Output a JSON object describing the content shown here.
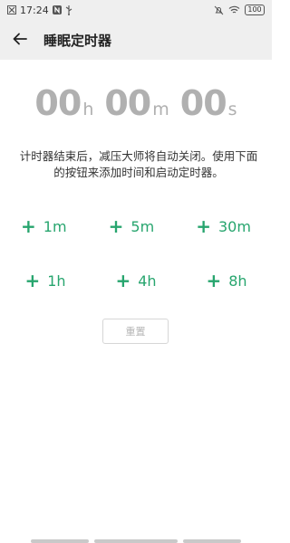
{
  "status_bar": {
    "time": "17:24",
    "battery": "100",
    "icons": [
      "x-box-icon",
      "notification-n-icon",
      "usb-icon",
      "mute-bell-icon",
      "wifi-icon",
      "battery-icon"
    ]
  },
  "app_bar": {
    "back_icon": "arrow-left-icon",
    "title": "睡眠定时器"
  },
  "timer": {
    "hours": "00",
    "hours_unit": "h",
    "minutes": "00",
    "minutes_unit": "m",
    "seconds": "00",
    "seconds_unit": "s"
  },
  "description": "计时器结束后，减压大师将自动关闭。使用下面的按钮来添加时间和启动定时器。",
  "add_buttons": {
    "plus_symbol": "+",
    "row1": [
      "1m",
      "5m",
      "30m"
    ],
    "row2": [
      "1h",
      "4h",
      "8h"
    ]
  },
  "reset_label": "重置",
  "colors": {
    "accent": "#27a56e",
    "timer_gray": "#b0b0b0",
    "bar_bg": "#efefef"
  }
}
